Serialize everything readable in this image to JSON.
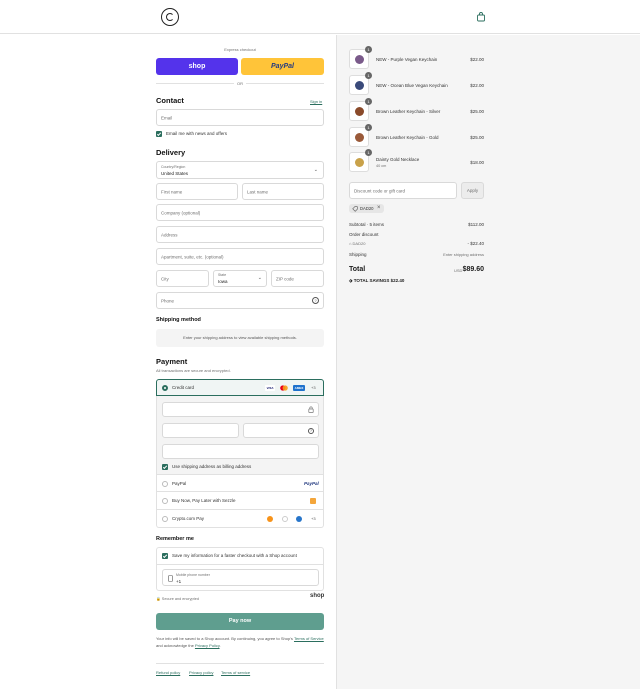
{
  "header": {
    "logo_name": "store-logo",
    "cart_icon": "shopping-bag-icon"
  },
  "express": {
    "label": "Express checkout",
    "shop": "shop",
    "paypal": "PayPal",
    "or": "OR"
  },
  "contact": {
    "title": "Contact",
    "sign_in": "Sign in",
    "email_placeholder": "Email",
    "newsletter": "Email me with news and offers"
  },
  "delivery": {
    "title": "Delivery",
    "country_label": "Country/Region",
    "country_value": "United States",
    "first_name": "First name",
    "last_name": "Last name",
    "company": "Company (optional)",
    "address": "Address",
    "apartment": "Apartment, suite, etc. (optional)",
    "city": "City",
    "state_label": "State",
    "state_value": "Iowa",
    "zip": "ZIP code",
    "phone": "Phone"
  },
  "shipping": {
    "title": "Shipping method",
    "message": "Enter your shipping address to view available shipping methods."
  },
  "payment": {
    "title": "Payment",
    "subtitle": "All transactions are secure and encrypted.",
    "credit_card": "Credit card",
    "card_more": "+3",
    "billing_same": "Use shipping address as billing address",
    "paypal": "PayPal",
    "paypal_logo": "PayPal",
    "sezzle": "Buy Now, Pay Later with Sezzle",
    "crypto": "Crypto.com Pay",
    "crypto_more": "+3"
  },
  "remember": {
    "title": "Remember me",
    "save_info": "Save my information for a faster checkout with a Shop account",
    "mobile_label": "Mobile phone number",
    "mobile_value": "+1",
    "secure": "Secure and encrypted",
    "shop_logo": "shop"
  },
  "pay_now": "Pay now",
  "legal": {
    "text1": "Your info will be saved to a Shop account. By continuing, you agree to Shop's",
    "terms": "Terms of Service",
    "text2": "and acknowledge the",
    "privacy": "Privacy Policy",
    "text3": "."
  },
  "footer_links": [
    "Refund policy",
    "Privacy policy",
    "Terms of service"
  ],
  "cart": {
    "items": [
      {
        "qty": "1",
        "name": "NEW - Purple Vegan Keychain",
        "variant": "",
        "price": "$22.00",
        "color": "#7a5a8a"
      },
      {
        "qty": "1",
        "name": "NEW - Ocean Blue Vegan Keychain",
        "variant": "",
        "price": "$22.00",
        "color": "#3a4a7a"
      },
      {
        "qty": "1",
        "name": "Brown Leather Keychain - Silver",
        "variant": "",
        "price": "$25.00",
        "color": "#8a4a2a"
      },
      {
        "qty": "1",
        "name": "Brown Leather Keychain - Gold",
        "variant": "",
        "price": "$25.00",
        "color": "#9a5a3a"
      },
      {
        "qty": "1",
        "name": "Dainty Gold Necklace",
        "variant": "40 cm",
        "price": "$18.00",
        "color": "#c9a24a"
      }
    ],
    "discount_placeholder": "Discount code or gift card",
    "apply": "Apply",
    "code_tag": "DAD20",
    "subtotal_label": "Subtotal · 5 items",
    "subtotal_value": "$112.00",
    "order_discount_label": "Order discount",
    "discount_code": "DAD20",
    "discount_value": "- $22.40",
    "shipping_label": "Shipping",
    "shipping_value": "Enter shipping address",
    "total_label": "Total",
    "currency": "USD",
    "total_value": "$89.60",
    "savings_label": "TOTAL SAVINGS",
    "savings_value": "$22.40"
  },
  "colors": {
    "accent": "#2b6e5e",
    "shop": "#5433eb",
    "paypal": "#ffc439",
    "paynow": "#5f9e8f"
  }
}
